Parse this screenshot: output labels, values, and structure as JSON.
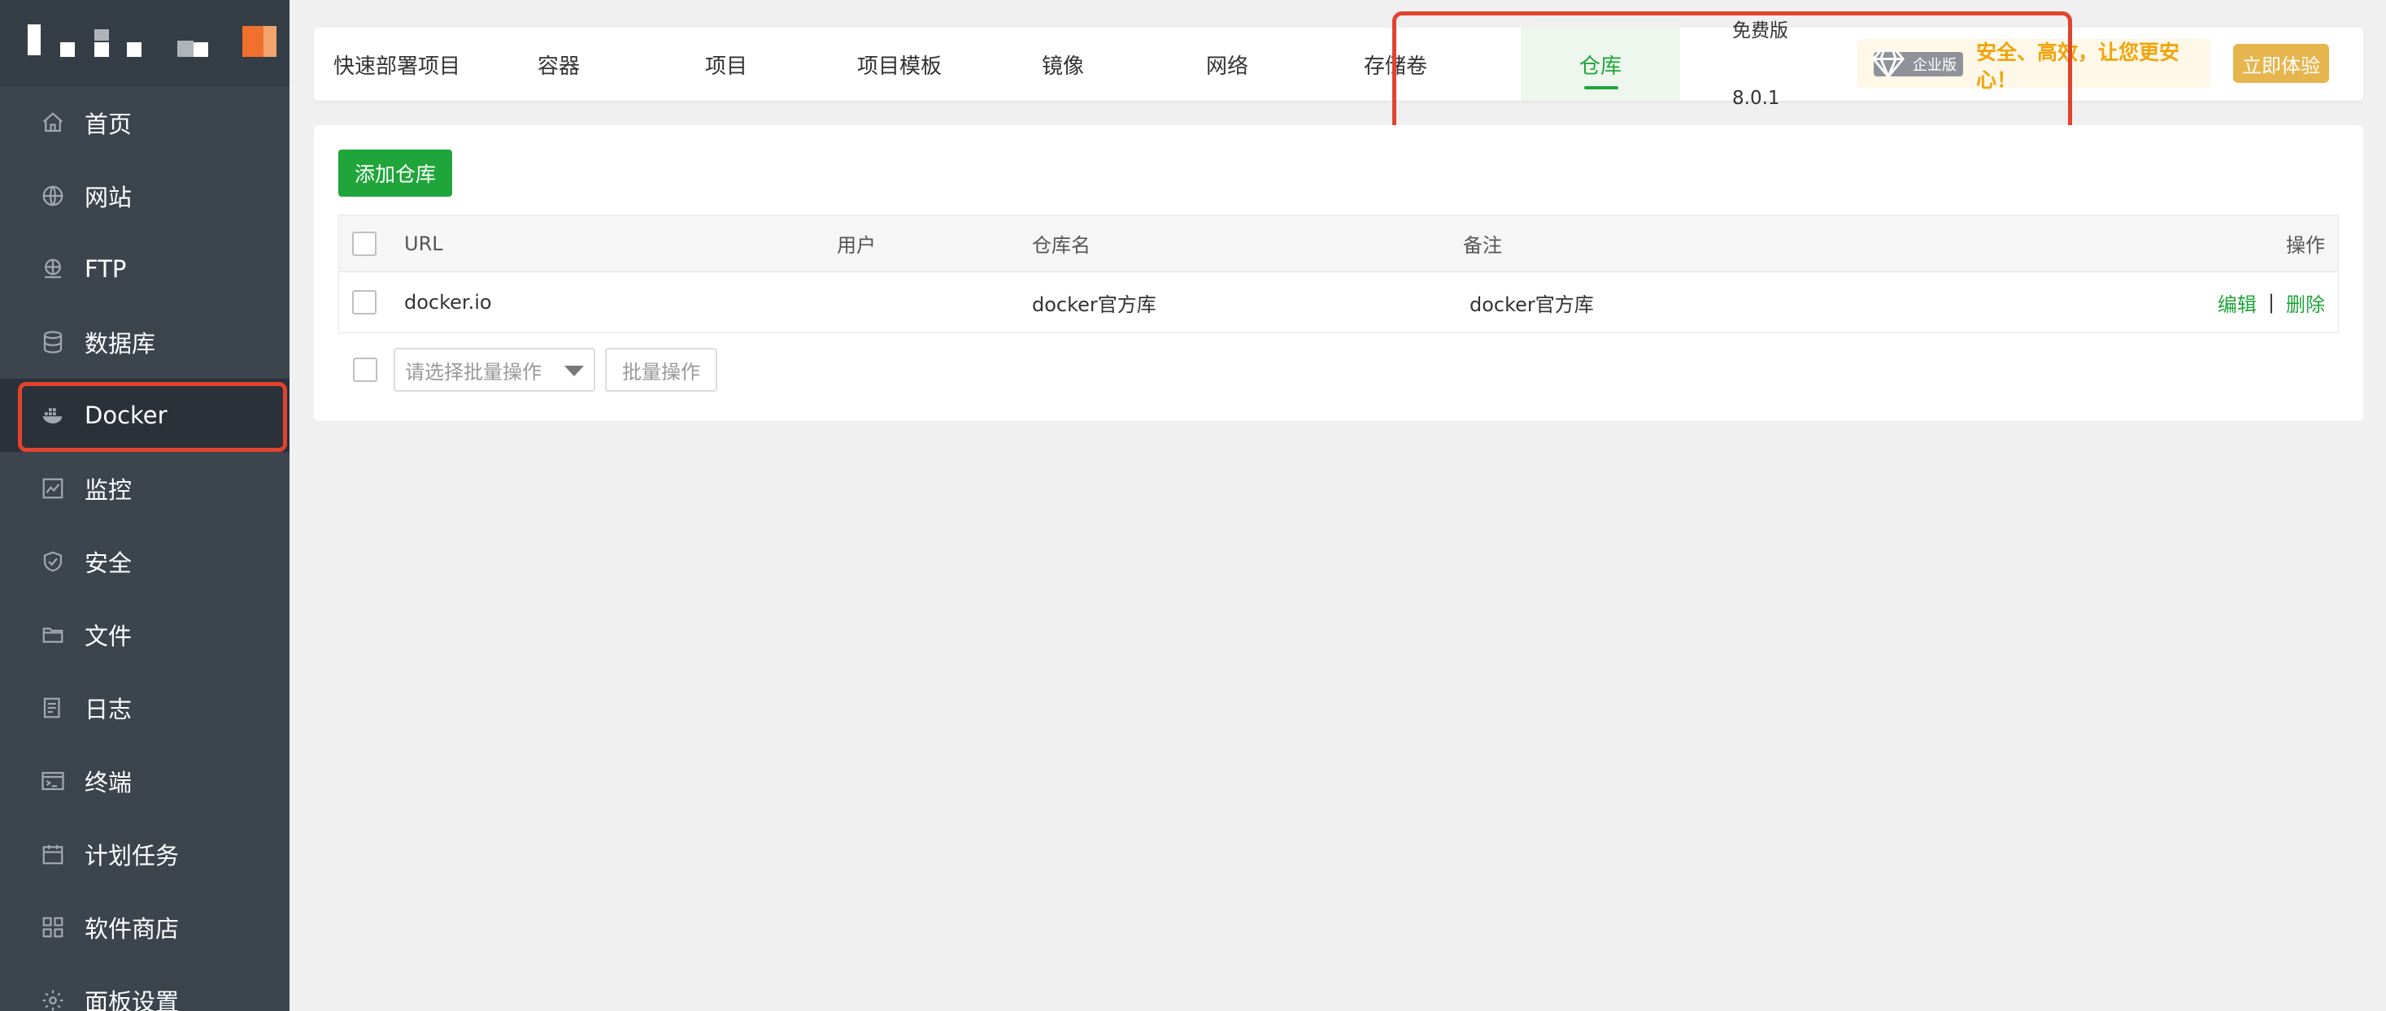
{
  "sidebar": {
    "items": [
      {
        "label": "首页",
        "icon": "home-icon"
      },
      {
        "label": "网站",
        "icon": "globe-icon"
      },
      {
        "label": "FTP",
        "icon": "ftp-icon"
      },
      {
        "label": "数据库",
        "icon": "database-icon"
      },
      {
        "label": "Docker",
        "icon": "docker-icon",
        "active": true
      },
      {
        "label": "监控",
        "icon": "monitor-icon"
      },
      {
        "label": "安全",
        "icon": "shield-icon"
      },
      {
        "label": "文件",
        "icon": "folder-icon"
      },
      {
        "label": "日志",
        "icon": "log-icon"
      },
      {
        "label": "终端",
        "icon": "terminal-icon"
      },
      {
        "label": "计划任务",
        "icon": "calendar-icon"
      },
      {
        "label": "软件商店",
        "icon": "apps-icon"
      },
      {
        "label": "面板设置",
        "icon": "settings-icon"
      }
    ]
  },
  "tabs": [
    {
      "label": "快速部署项目"
    },
    {
      "label": "容器"
    },
    {
      "label": "项目"
    },
    {
      "label": "项目模板"
    },
    {
      "label": "镜像"
    },
    {
      "label": "网络"
    },
    {
      "label": "存储卷"
    },
    {
      "label": "仓库",
      "active": true
    }
  ],
  "edition": {
    "name": "免费版",
    "version": "8.0.1"
  },
  "promo": {
    "badge": "企业版",
    "text": "安全、高效，让您更安心！",
    "button": "立即体验"
  },
  "toolbar": {
    "add_label": "添加仓库"
  },
  "table": {
    "headers": {
      "url": "URL",
      "user": "用户",
      "name": "仓库名",
      "note": "备注",
      "ops": "操作"
    },
    "rows": [
      {
        "url": "docker.io",
        "user": "",
        "name": "docker官方库",
        "note": "docker官方库",
        "edit": "编辑",
        "sep": "|",
        "delete": "删除"
      }
    ]
  },
  "batch": {
    "select_placeholder": "请选择批量操作",
    "button": "批量操作"
  },
  "colors": {
    "sidebar_bg": "#3c444d",
    "accent_green": "#20a53a",
    "highlight_red": "#e2432e",
    "promo_orange": "#f0a40c"
  }
}
